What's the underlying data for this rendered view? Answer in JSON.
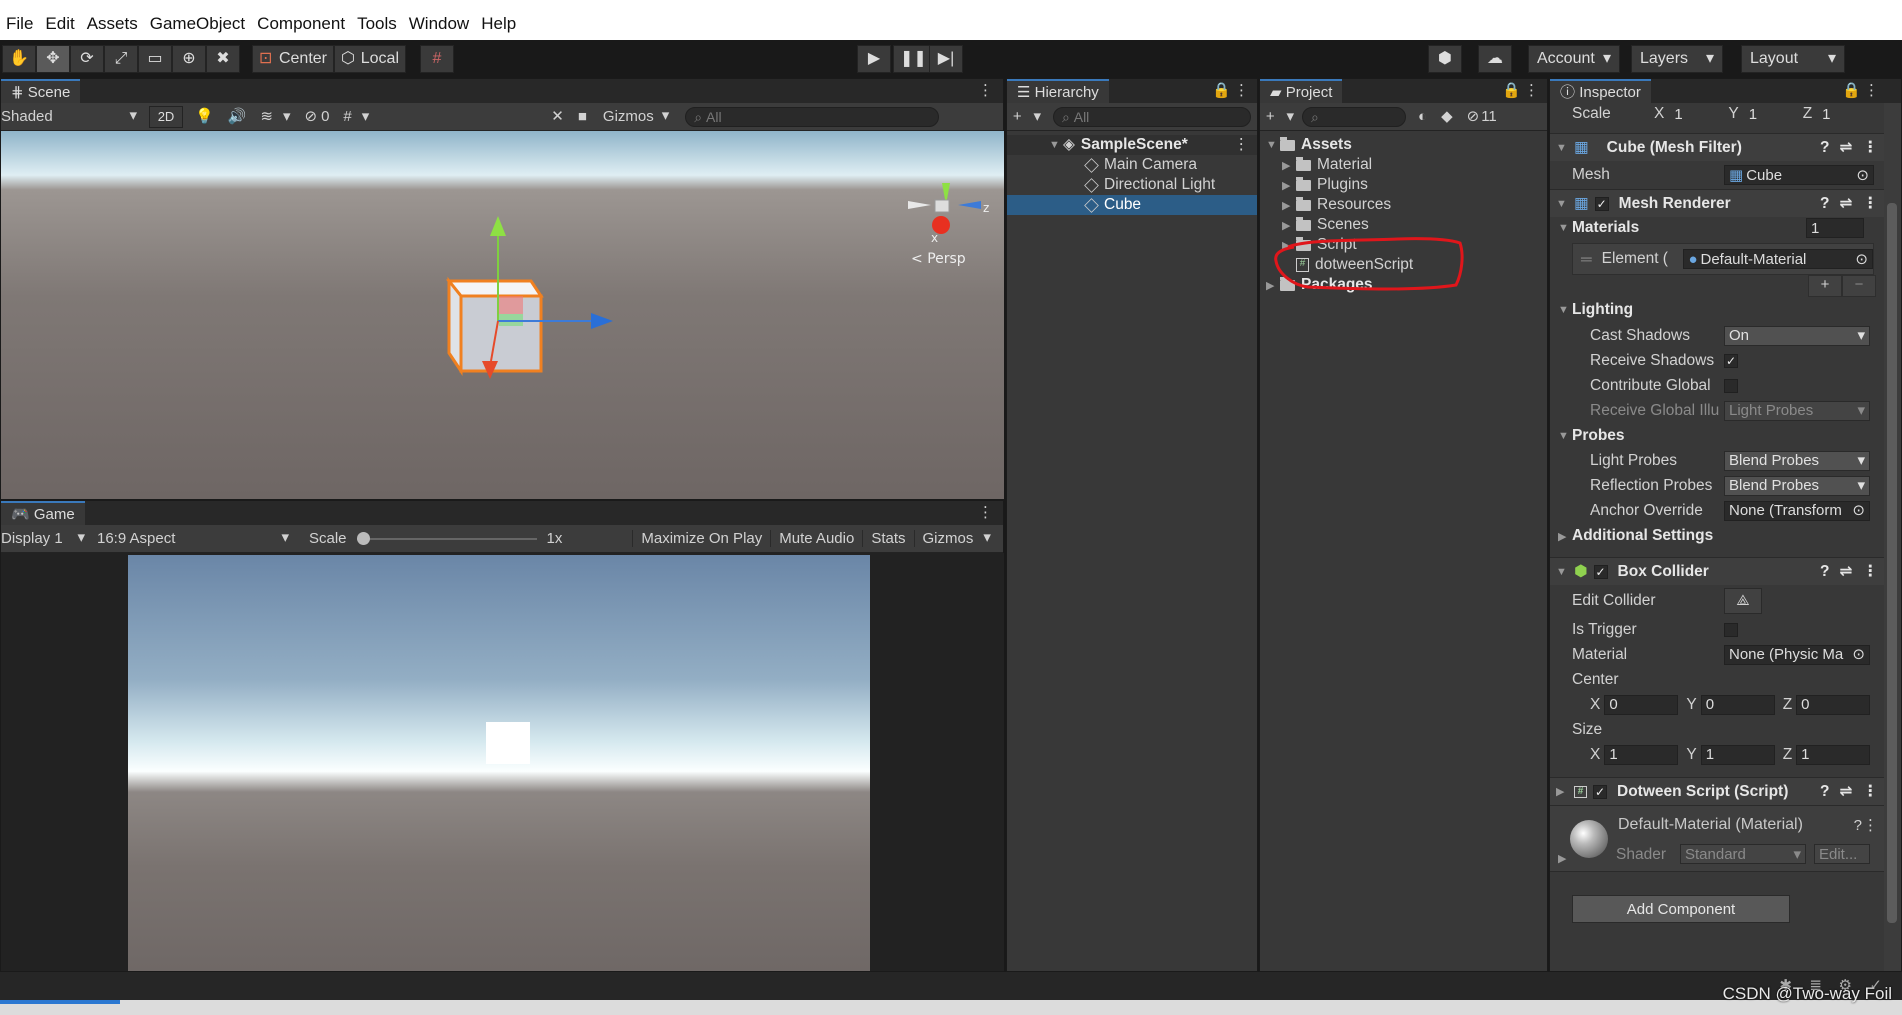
{
  "menu": [
    "File",
    "Edit",
    "Assets",
    "GameObject",
    "Component",
    "Tools",
    "Window",
    "Help"
  ],
  "toolbar": {
    "center": "Center",
    "local": "Local",
    "account": "Account",
    "layers": "Layers",
    "layout": "Layout"
  },
  "scene": {
    "tab": "Scene",
    "shading": "Shaded",
    "mode2d": "2D",
    "hidden_count": "0",
    "gizmos": "Gizmos",
    "search_placeholder": "All",
    "persp": "Persp",
    "axis_x": "x",
    "axis_z": "z"
  },
  "game": {
    "tab": "Game",
    "display": "Display 1",
    "aspect": "16:9 Aspect",
    "scale_label": "Scale",
    "scale_value": "1x",
    "maximize": "Maximize On Play",
    "mute": "Mute Audio",
    "stats": "Stats",
    "gizmos": "Gizmos"
  },
  "hierarchy": {
    "tab": "Hierarchy",
    "search_placeholder": "All",
    "scene_name": "SampleScene*",
    "items": [
      "Main Camera",
      "Directional Light",
      "Cube"
    ]
  },
  "project": {
    "tab": "Project",
    "hidden_count": "11",
    "assets": "Assets",
    "folders": [
      "Material",
      "Plugins",
      "Resources",
      "Scenes",
      "Script"
    ],
    "script_file": "dotweenScript",
    "packages": "Packages"
  },
  "inspector": {
    "tab": "Inspector",
    "scale": {
      "label": "Scale",
      "x": "1",
      "y": "1",
      "z": "1"
    },
    "mesh_filter": {
      "title": "Cube (Mesh Filter)",
      "mesh_label": "Mesh",
      "mesh_value": "Cube"
    },
    "mesh_renderer": {
      "title": "Mesh Renderer",
      "materials_label": "Materials",
      "materials_count": "1",
      "element_label": "Element (",
      "element_value": "Default-Material",
      "lighting": "Lighting",
      "cast_shadows_label": "Cast Shadows",
      "cast_shadows_value": "On",
      "receive_shadows_label": "Receive Shadows",
      "contribute_gi_label": "Contribute Global",
      "receive_gi_label": "Receive Global Illu",
      "receive_gi_value": "Light Probes",
      "probes": "Probes",
      "light_probes_label": "Light Probes",
      "light_probes_value": "Blend Probes",
      "reflection_probes_label": "Reflection Probes",
      "reflection_probes_value": "Blend Probes",
      "anchor_label": "Anchor Override",
      "anchor_value": "None (Transform",
      "additional": "Additional Settings"
    },
    "box_collider": {
      "title": "Box Collider",
      "edit_label": "Edit Collider",
      "trigger_label": "Is Trigger",
      "material_label": "Material",
      "material_value": "None (Physic Ma",
      "center_label": "Center",
      "cx": "0",
      "cy": "0",
      "cz": "0",
      "size_label": "Size",
      "sx": "1",
      "sy": "1",
      "sz": "1"
    },
    "script": {
      "title": "Dotween Script (Script)"
    },
    "material": {
      "title": "Default-Material (Material)",
      "shader_label": "Shader",
      "shader_value": "Standard",
      "edit": "Edit..."
    },
    "add_component": "Add Component"
  },
  "watermark": "CSDN @Two-way Foil",
  "colors": {
    "accent": "#3a79bb",
    "selection": "#2c5d87",
    "annotation": "#e0161b"
  }
}
